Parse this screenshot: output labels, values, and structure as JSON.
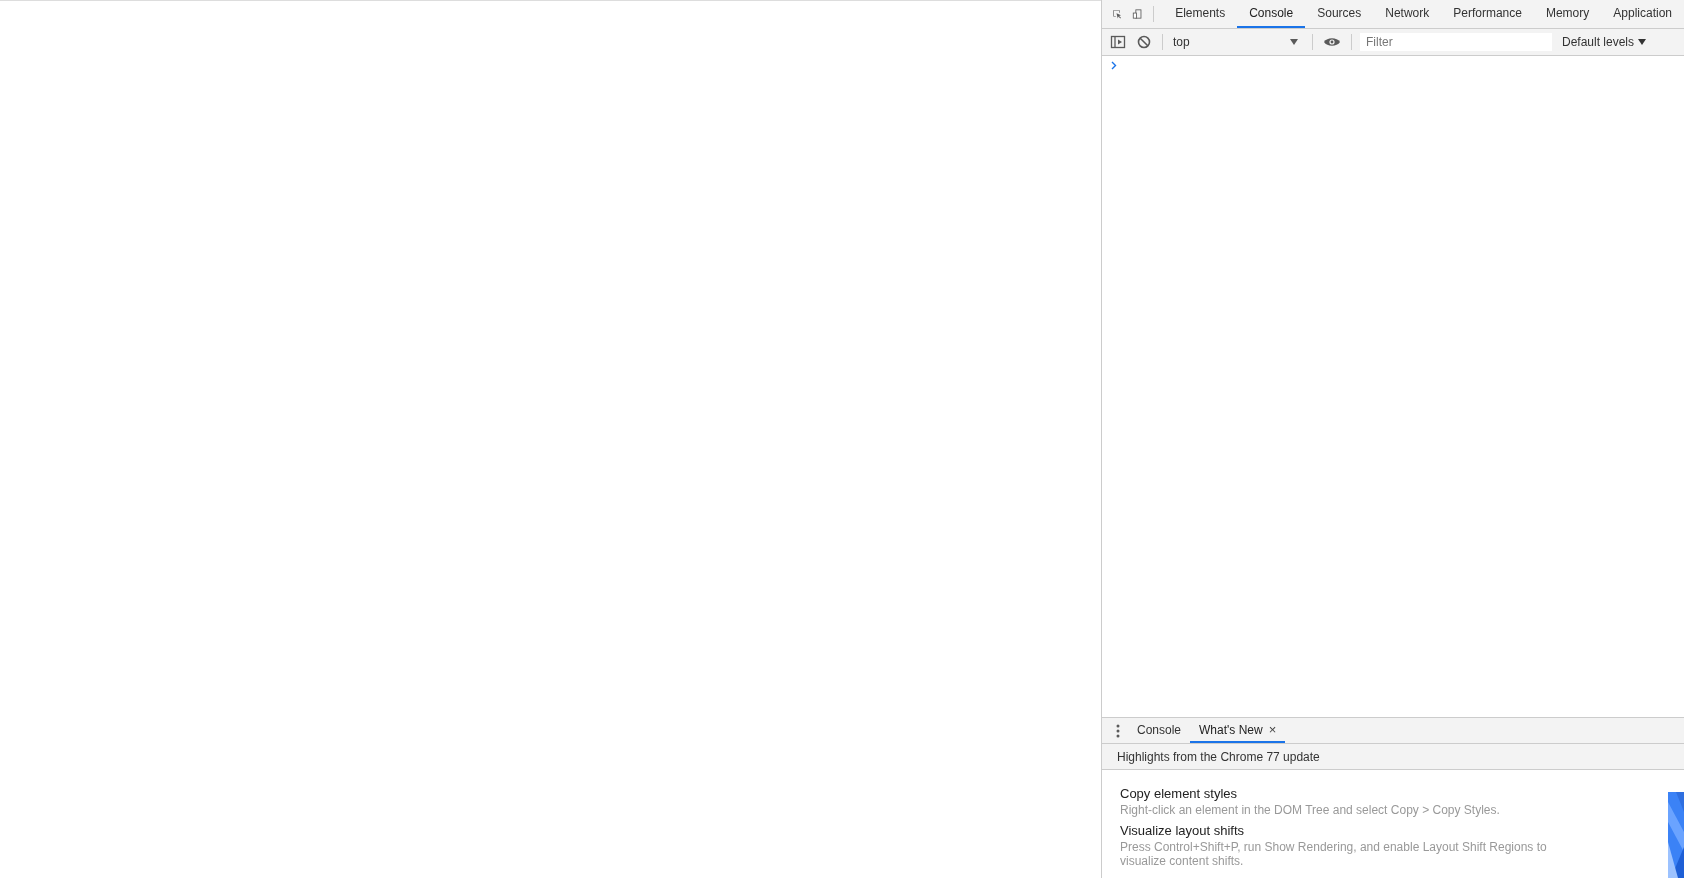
{
  "tabs": [
    {
      "label": "Elements",
      "selected": false
    },
    {
      "label": "Console",
      "selected": true
    },
    {
      "label": "Sources",
      "selected": false
    },
    {
      "label": "Network",
      "selected": false
    },
    {
      "label": "Performance",
      "selected": false
    },
    {
      "label": "Memory",
      "selected": false
    },
    {
      "label": "Application",
      "selected": false
    }
  ],
  "console_toolbar": {
    "context": "top",
    "filter": {
      "placeholder": "Filter"
    },
    "levels": "Default levels"
  },
  "drawer": {
    "tabs": [
      {
        "label": "Console",
        "selected": false
      },
      {
        "label": "What's New",
        "selected": true,
        "close": "×"
      }
    ],
    "header": "Highlights from the Chrome 77 update",
    "items": [
      {
        "title": "Copy element styles",
        "description": "Right-click an element in the DOM Tree and select Copy > Copy Styles."
      },
      {
        "title": "Visualize layout shifts",
        "description": "Press Control+Shift+P, run Show Rendering, and enable Layout Shift Regions to visualize content shifts."
      }
    ]
  }
}
